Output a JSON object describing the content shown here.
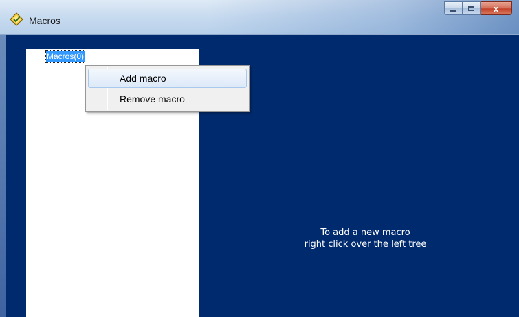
{
  "window": {
    "title": "Macros",
    "icon": "macro-app-icon",
    "controls": {
      "minimize_icon": "minimize-icon",
      "maximize_icon": "maximize-icon",
      "close_glyph": "x"
    }
  },
  "tree": {
    "root_label": "Macros(0)"
  },
  "content": {
    "hint_line1": "To add a new macro",
    "hint_line2": "right click over the left tree"
  },
  "context_menu": {
    "items": [
      {
        "label": "Add macro",
        "highlighted": true
      },
      {
        "label": "Remove macro",
        "highlighted": false
      }
    ]
  },
  "colors": {
    "panel_background": "#002a6e",
    "tree_background": "#ffffff",
    "selection": "#3399ff",
    "close_button": "#c4432b"
  }
}
